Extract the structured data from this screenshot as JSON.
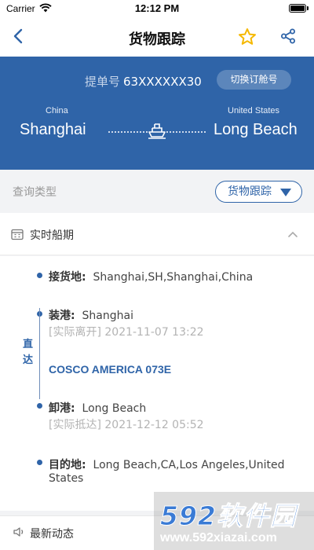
{
  "status_bar": {
    "carrier": "Carrier",
    "time": "12:12 PM"
  },
  "navbar": {
    "title": "货物跟踪"
  },
  "hero": {
    "bill_label": "提单号",
    "bill_number": "63XXXXXX30",
    "switch_label": "切换订舱号",
    "origin": {
      "country": "China",
      "city": "Shanghai"
    },
    "destination": {
      "country": "United States",
      "city": "Long Beach"
    }
  },
  "query": {
    "label": "查询类型",
    "selected": "货物跟踪"
  },
  "schedule": {
    "title": "实时船期",
    "direct_label": "直达",
    "receipt": {
      "label": "接货地:",
      "value": "Shanghai,SH,Shanghai,China"
    },
    "pol": {
      "label": "装港:",
      "value": "Shanghai",
      "status": "[实际离开] 2021-11-07 13:22"
    },
    "vessel": "COSCO AMERICA 073E",
    "pod": {
      "label": "卸港:",
      "value": "Long Beach",
      "status": "[实际抵达] 2021-12-12 05:52"
    },
    "destination": {
      "label": "目的地:",
      "value_line1": "Long Beach,CA,Los Angeles,United",
      "value_line2": "States"
    }
  },
  "news": {
    "title": "最新动态"
  },
  "watermark": {
    "title": "592软件园",
    "url": "www.592xiazai.com"
  },
  "colors": {
    "primary": "#2f64a8",
    "star": "#f5b800"
  }
}
